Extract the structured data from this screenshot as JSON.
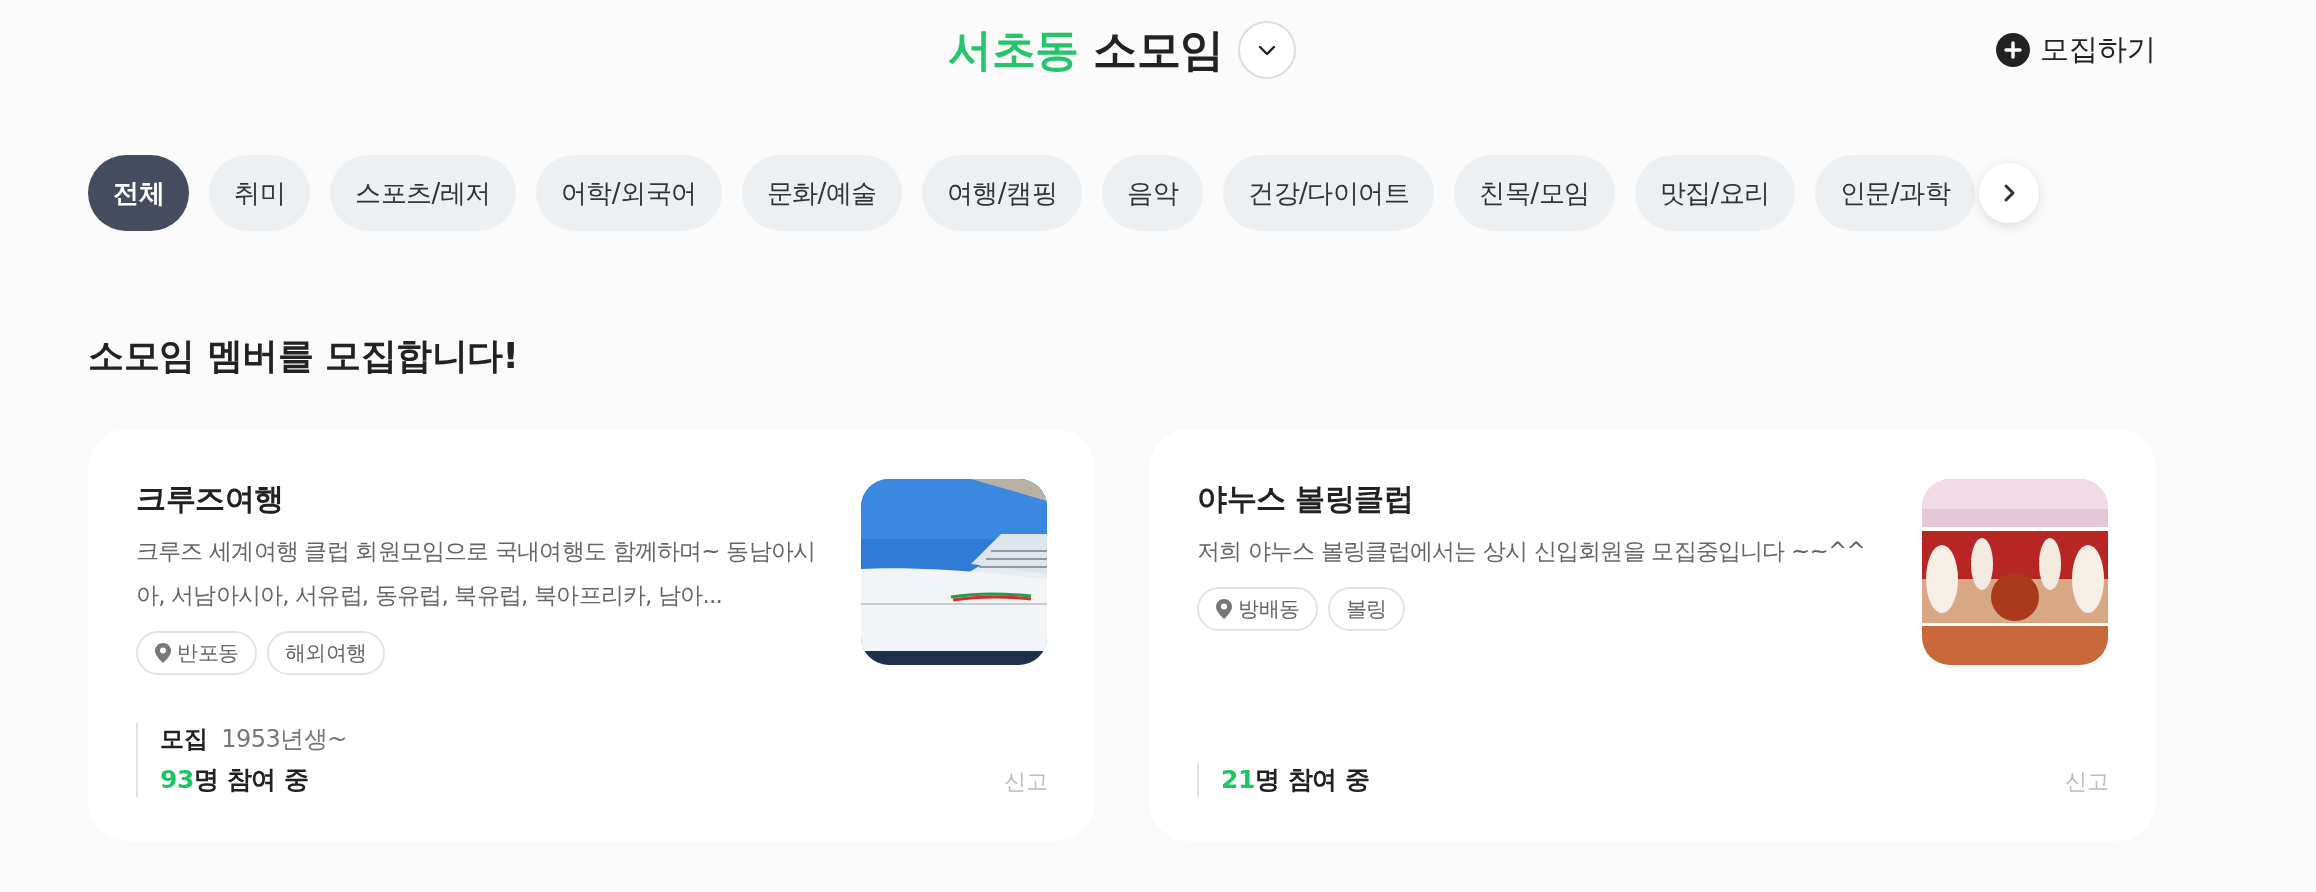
{
  "header": {
    "region": "서초동",
    "title": "소모임",
    "create_button": "모집하기"
  },
  "categories": [
    {
      "label": "전체",
      "selected": true
    },
    {
      "label": "취미",
      "selected": false
    },
    {
      "label": "스포츠/레저",
      "selected": false
    },
    {
      "label": "어학/외국어",
      "selected": false
    },
    {
      "label": "문화/예술",
      "selected": false
    },
    {
      "label": "여행/캠핑",
      "selected": false
    },
    {
      "label": "음악",
      "selected": false
    },
    {
      "label": "건강/다이어트",
      "selected": false
    },
    {
      "label": "친목/모임",
      "selected": false
    },
    {
      "label": "맛집/요리",
      "selected": false
    },
    {
      "label": "인문/과학",
      "selected": false
    }
  ],
  "section_title": "소모임 멤버를 모집합니다!",
  "groups": [
    {
      "name": "크루즈여행",
      "description": "크루즈 세계여행 클럽 회원모임으로 국내여행도 함께하며~ 동남아시아, 서남아시아, 서유럽, 동유럽, 북유럽, 북아프리카, 남아...",
      "location": "반포동",
      "tag": "해외여행",
      "recruit_label": "모집",
      "recruit_value": "1953년생~",
      "count": "93",
      "count_suffix": "명 참여 중",
      "report": "신고"
    },
    {
      "name": "야누스 볼링클럽",
      "description": "저희 야누스 볼링클럽에서는 상시 신입회원을 모집중입니다 ~~^^",
      "location": "방배동",
      "tag": "볼링",
      "count": "21",
      "count_suffix": "명 참여 중",
      "report": "신고"
    }
  ]
}
